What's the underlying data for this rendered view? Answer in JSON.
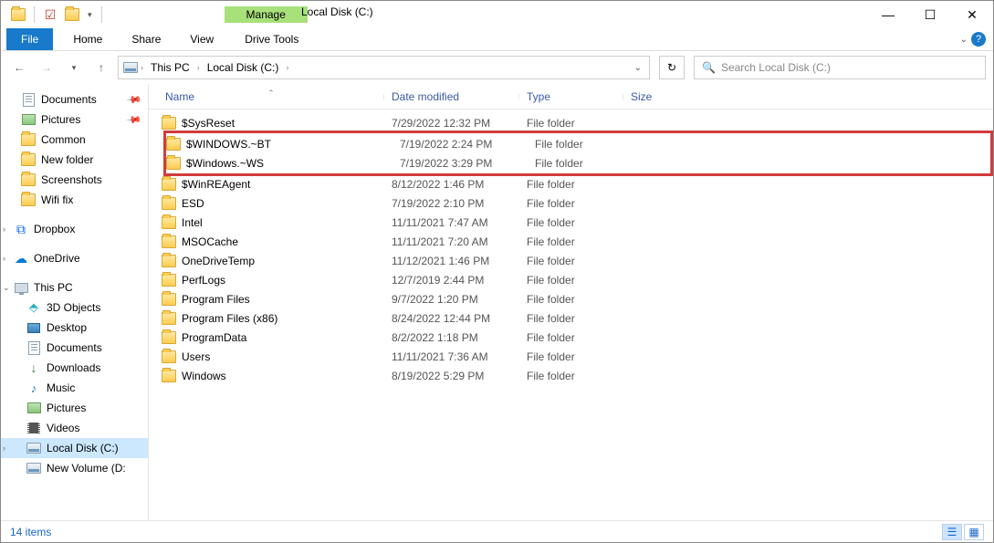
{
  "window": {
    "title": "Local Disk (C:)",
    "ribbon_context_label": "Manage",
    "ribbon_context_tab": "Drive Tools"
  },
  "ribbon_tabs": {
    "file": "File",
    "home": "Home",
    "share": "Share",
    "view": "View"
  },
  "breadcrumb": {
    "root": "This PC",
    "current": "Local Disk (C:)"
  },
  "search": {
    "placeholder": "Search Local Disk (C:)"
  },
  "sidebar": {
    "quick": [
      {
        "label": "Documents",
        "icon": "doc",
        "pinned": true
      },
      {
        "label": "Pictures",
        "icon": "pic",
        "pinned": true
      },
      {
        "label": "Common",
        "icon": "folder",
        "pinned": false
      },
      {
        "label": "New folder",
        "icon": "folder",
        "pinned": false
      },
      {
        "label": "Screenshots",
        "icon": "folder",
        "pinned": false
      },
      {
        "label": "Wifi fix",
        "icon": "folder",
        "pinned": false
      }
    ],
    "dropbox": "Dropbox",
    "onedrive": "OneDrive",
    "thispc": "This PC",
    "pc_items": [
      {
        "label": "3D Objects",
        "icon": "cube"
      },
      {
        "label": "Desktop",
        "icon": "desk"
      },
      {
        "label": "Documents",
        "icon": "doc"
      },
      {
        "label": "Downloads",
        "icon": "dl"
      },
      {
        "label": "Music",
        "icon": "music"
      },
      {
        "label": "Pictures",
        "icon": "pic"
      },
      {
        "label": "Videos",
        "icon": "vid"
      },
      {
        "label": "Local Disk (C:)",
        "icon": "disk",
        "selected": true
      },
      {
        "label": "New Volume (D:",
        "icon": "disk"
      }
    ]
  },
  "columns": {
    "name": "Name",
    "date": "Date modified",
    "type": "Type",
    "size": "Size"
  },
  "files": [
    {
      "name": "$SysReset",
      "date": "7/29/2022 12:32 PM",
      "type": "File folder"
    },
    {
      "name": "$WINDOWS.~BT",
      "date": "7/19/2022 2:24 PM",
      "type": "File folder",
      "hl": true
    },
    {
      "name": "$Windows.~WS",
      "date": "7/19/2022 3:29 PM",
      "type": "File folder",
      "hl": true
    },
    {
      "name": "$WinREAgent",
      "date": "8/12/2022 1:46 PM",
      "type": "File folder"
    },
    {
      "name": "ESD",
      "date": "7/19/2022 2:10 PM",
      "type": "File folder"
    },
    {
      "name": "Intel",
      "date": "11/11/2021 7:47 AM",
      "type": "File folder"
    },
    {
      "name": "MSOCache",
      "date": "11/11/2021 7:20 AM",
      "type": "File folder"
    },
    {
      "name": "OneDriveTemp",
      "date": "11/12/2021 1:46 PM",
      "type": "File folder"
    },
    {
      "name": "PerfLogs",
      "date": "12/7/2019 2:44 PM",
      "type": "File folder"
    },
    {
      "name": "Program Files",
      "date": "9/7/2022 1:20 PM",
      "type": "File folder"
    },
    {
      "name": "Program Files (x86)",
      "date": "8/24/2022 12:44 PM",
      "type": "File folder"
    },
    {
      "name": "ProgramData",
      "date": "8/2/2022 1:18 PM",
      "type": "File folder"
    },
    {
      "name": "Users",
      "date": "11/11/2021 7:36 AM",
      "type": "File folder"
    },
    {
      "name": "Windows",
      "date": "8/19/2022 5:29 PM",
      "type": "File folder"
    }
  ],
  "status": {
    "text": "14 items"
  }
}
